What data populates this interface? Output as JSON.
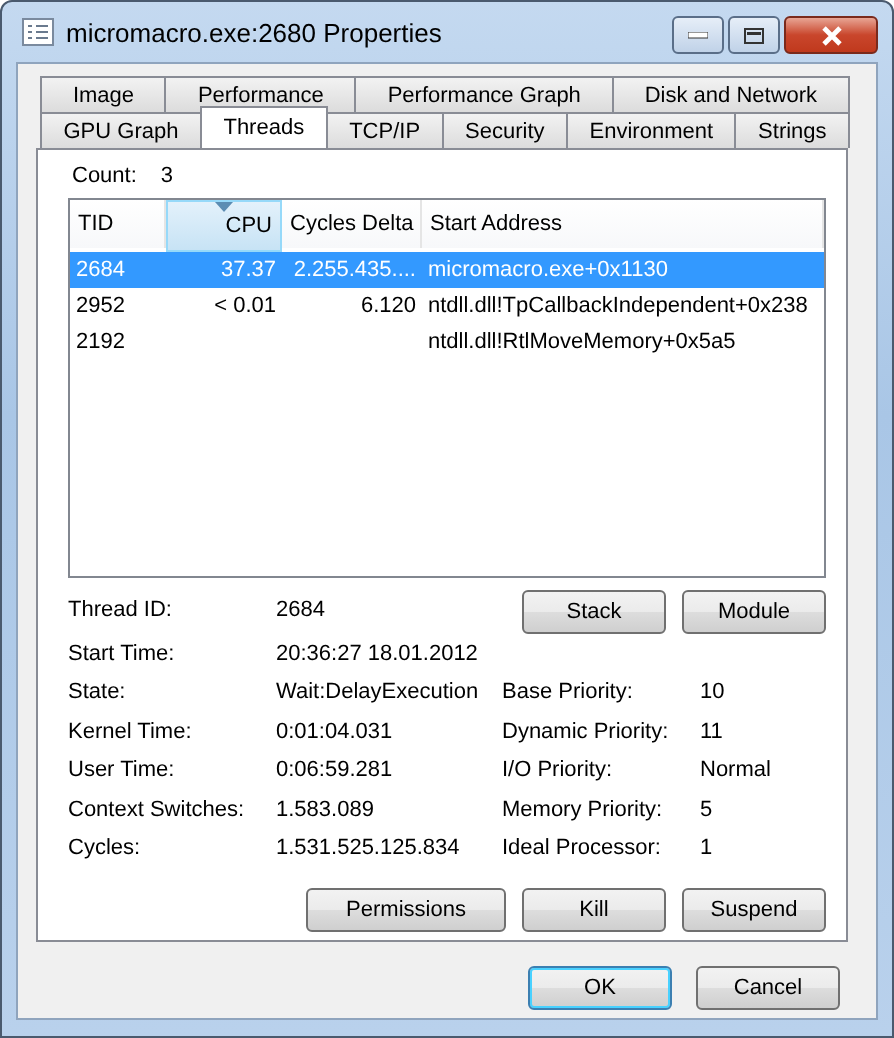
{
  "window": {
    "title": "micromacro.exe:2680 Properties"
  },
  "tab_rows": [
    [
      {
        "label": "Image",
        "selected": false
      },
      {
        "label": "Performance",
        "selected": false
      },
      {
        "label": "Performance Graph",
        "selected": false
      },
      {
        "label": "Disk and Network",
        "selected": false
      }
    ],
    [
      {
        "label": "GPU Graph",
        "selected": false
      },
      {
        "label": "Threads",
        "selected": true
      },
      {
        "label": "TCP/IP",
        "selected": false
      },
      {
        "label": "Security",
        "selected": false
      },
      {
        "label": "Environment",
        "selected": false
      },
      {
        "label": "Strings",
        "selected": false
      }
    ]
  ],
  "count": {
    "label": "Count:",
    "value": "3"
  },
  "table": {
    "columns": [
      {
        "label": "TID",
        "sorted": false
      },
      {
        "label": "CPU",
        "sorted": true
      },
      {
        "label": "Cycles Delta",
        "sorted": false
      },
      {
        "label": "Start Address",
        "sorted": false
      }
    ],
    "rows": [
      {
        "tid": "2684",
        "cpu": "37.37",
        "cycles_delta": "2.255.435....",
        "start_address": "micromacro.exe+0x1130",
        "selected": true
      },
      {
        "tid": "2952",
        "cpu": "< 0.01",
        "cycles_delta": "6.120",
        "start_address": "ntdll.dll!TpCallbackIndependent+0x238",
        "selected": false
      },
      {
        "tid": "2192",
        "cpu": "",
        "cycles_delta": "",
        "start_address": "ntdll.dll!RtlMoveMemory+0x5a5",
        "selected": false
      }
    ]
  },
  "details": {
    "left": [
      {
        "label": "Thread ID:",
        "value": "2684"
      },
      {
        "label": "Start Time:",
        "value": "20:36:27   18.01.2012"
      },
      {
        "label": "State:",
        "value": "Wait:DelayExecution"
      },
      {
        "label": "Kernel Time:",
        "value": "0:01:04.031"
      },
      {
        "label": "User Time:",
        "value": "0:06:59.281"
      },
      {
        "label": "Context Switches:",
        "value": "1.583.089"
      },
      {
        "label": "Cycles:",
        "value": "1.531.525.125.834"
      }
    ],
    "right": [
      {
        "label": "Base Priority:",
        "value": "10"
      },
      {
        "label": "Dynamic Priority:",
        "value": "11"
      },
      {
        "label": "I/O Priority:",
        "value": "Normal"
      },
      {
        "label": "Memory Priority:",
        "value": "5"
      },
      {
        "label": "Ideal Processor:",
        "value": "1"
      }
    ]
  },
  "thread_buttons": [
    "Stack",
    "Module"
  ],
  "action_buttons": [
    "Permissions",
    "Kill",
    "Suspend"
  ],
  "dialog_buttons": [
    {
      "label": "OK",
      "default": true
    },
    {
      "label": "Cancel",
      "default": false
    }
  ]
}
